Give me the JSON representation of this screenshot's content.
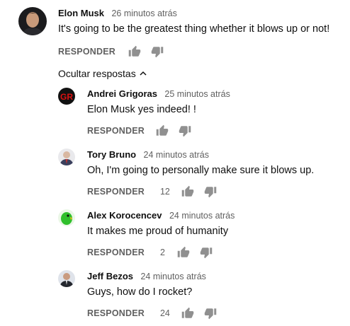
{
  "top_comment": {
    "author": "Elon Musk",
    "time": "26 minutos atrás",
    "text": "It's going to be the greatest thing whether it blows up or not!",
    "reply_label": "RESPONDER",
    "likes": ""
  },
  "toggle_label": "Ocultar respostas",
  "replies": [
    {
      "author": "Andrei Grigoras",
      "time": "25 minutos atrás",
      "text": "Elon Musk yes indeed! !",
      "reply_label": "RESPONDER",
      "likes": "",
      "avatar_text": "GR"
    },
    {
      "author": "Tory Bruno",
      "time": "24 minutos atrás",
      "text": "Oh, I'm going to personally make sure it blows up.",
      "reply_label": "RESPONDER",
      "likes": "12"
    },
    {
      "author": "Alex Korocencev",
      "time": "24 minutos atrás",
      "text": "It makes me proud of humanity",
      "reply_label": "RESPONDER",
      "likes": "2"
    },
    {
      "author": "Jeff Bezos",
      "time": "24 minutos atrás",
      "text": "Guys, how do I rocket?",
      "reply_label": "RESPONDER",
      "likes": "24"
    }
  ],
  "colors": {
    "text": "#0f0f0f",
    "secondary": "#606060",
    "icon": "#909090"
  }
}
